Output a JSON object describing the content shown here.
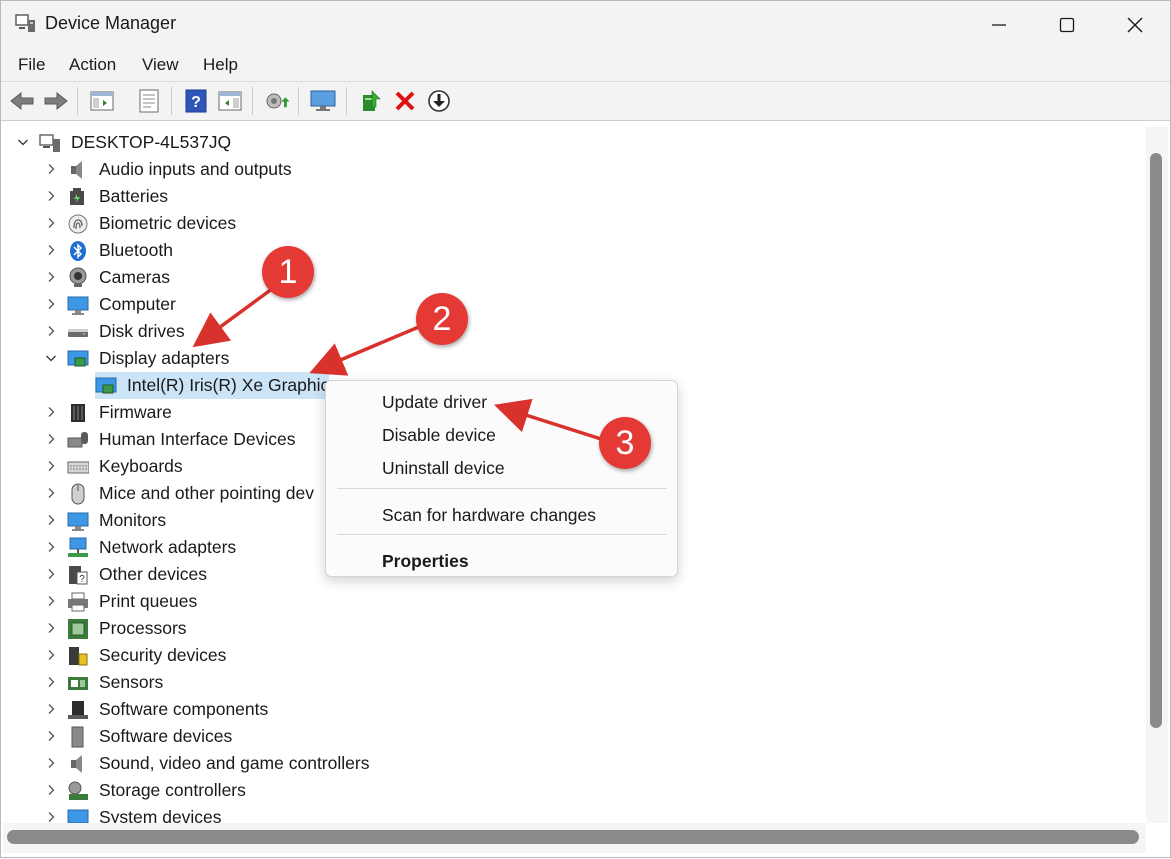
{
  "window": {
    "title": "Device Manager",
    "controls": [
      "minimize",
      "maximize",
      "close"
    ]
  },
  "menu": [
    "File",
    "Action",
    "View",
    "Help"
  ],
  "toolbar_icons": [
    "back-icon",
    "forward-icon",
    "show-hide-console-tree-icon",
    "properties-icon",
    "help-icon",
    "action-pane-icon",
    "scan-hardware-icon",
    "computer-monitor-icon",
    "update-driver-icon",
    "uninstall-icon",
    "download-icon"
  ],
  "tree": {
    "root": "DESKTOP-4L537JQ",
    "categories": [
      "Audio inputs and outputs",
      "Batteries",
      "Biometric devices",
      "Bluetooth",
      "Cameras",
      "Computer",
      "Disk drives",
      "Display adapters",
      "Intel(R) Iris(R) Xe Graphics",
      "Firmware",
      "Human Interface Devices",
      "Keyboards",
      "Mice and other pointing dev",
      "Monitors",
      "Network adapters",
      "Other devices",
      "Print queues",
      "Processors",
      "Security devices",
      "Sensors",
      "Software components",
      "Software devices",
      "Sound, video and game controllers",
      "Storage controllers",
      "System devices"
    ]
  },
  "context_menu": {
    "items": [
      "Update driver",
      "Disable device",
      "Uninstall device",
      "Scan for hardware changes",
      "Properties"
    ]
  },
  "annotations": [
    "1",
    "2",
    "3"
  ],
  "colors": {
    "accent_selection": "#cce4f7",
    "annotation_red": "#e53935"
  }
}
